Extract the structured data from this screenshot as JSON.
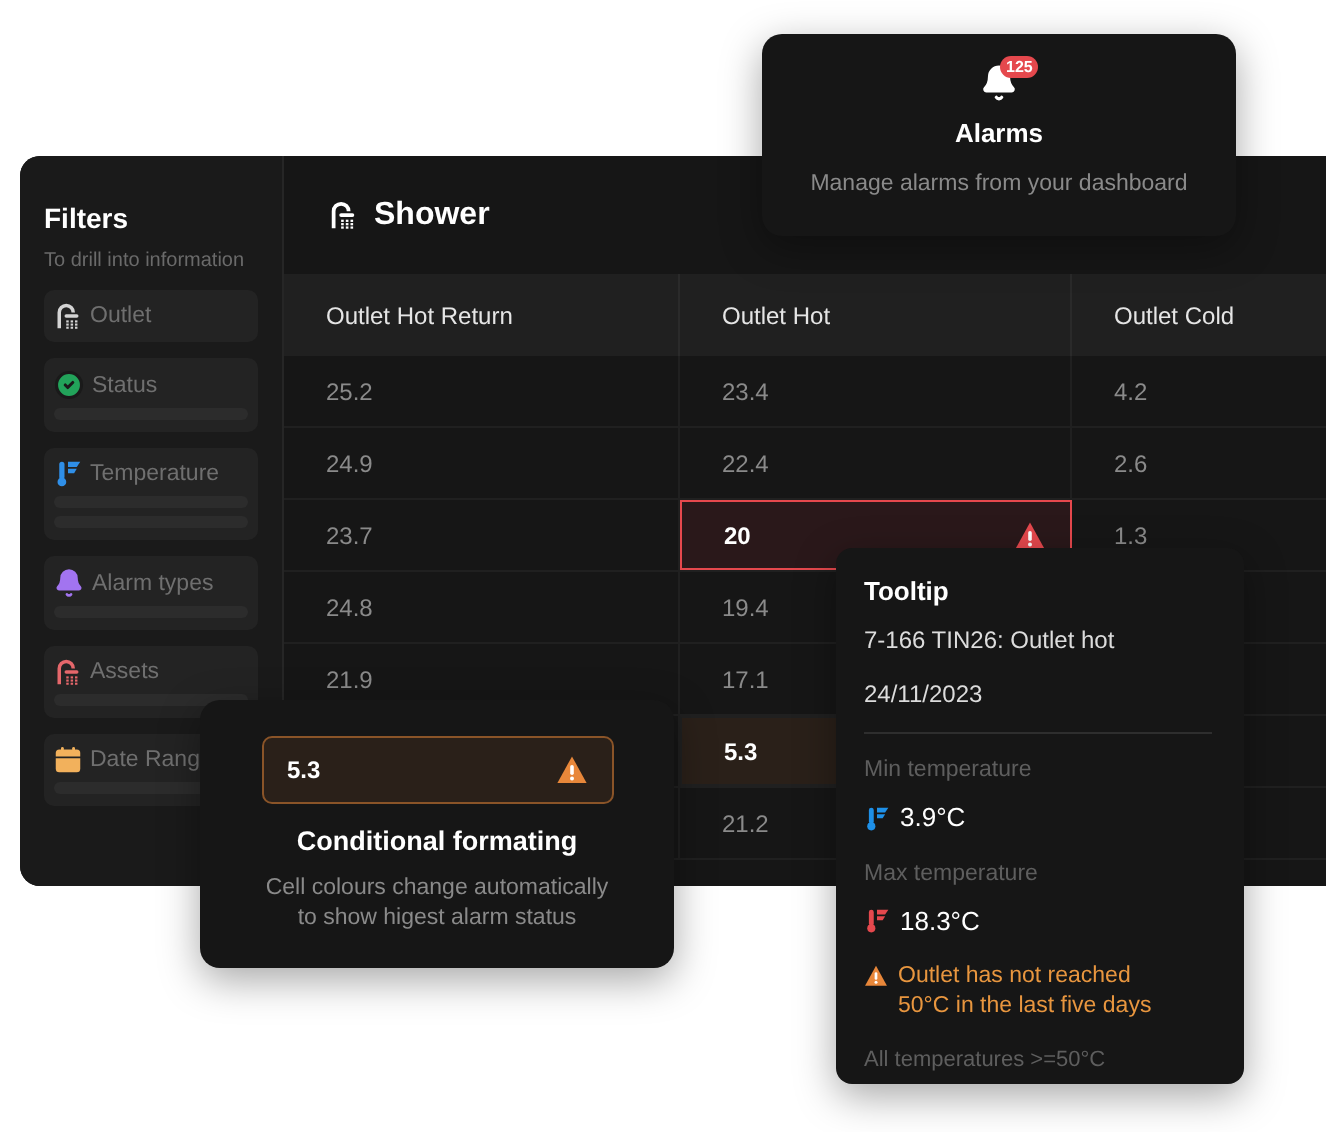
{
  "filters": {
    "title": "Filters",
    "subtitle": "To drill into information",
    "items": [
      {
        "label": "Outlet",
        "color": "#d4d4d4",
        "kind": "outlet"
      },
      {
        "label": "Status",
        "color": "#22a35a",
        "kind": "status"
      },
      {
        "label": "Temperature",
        "color": "#2f8fe8",
        "kind": "temperature"
      },
      {
        "label": "Alarm types",
        "color": "#a274f0",
        "kind": "alarm"
      },
      {
        "label": "Assets",
        "color": "#e5676b",
        "kind": "assets"
      },
      {
        "label": "Date Rang",
        "color": "#f2b15c",
        "kind": "date"
      }
    ]
  },
  "table": {
    "title": "Shower",
    "columns": [
      "Outlet Hot Return",
      "Outlet Hot",
      "Outlet Cold"
    ],
    "rows": [
      {
        "cells": [
          {
            "value": "25.2",
            "kind": "normal"
          },
          {
            "value": "23.4",
            "kind": "normal"
          },
          {
            "value": "4.2",
            "kind": "normal"
          }
        ]
      },
      {
        "cells": [
          {
            "value": "24.9",
            "kind": "normal"
          },
          {
            "value": "22.4",
            "kind": "normal"
          },
          {
            "value": "2.6",
            "kind": "normal"
          }
        ]
      },
      {
        "cells": [
          {
            "value": "23.7",
            "kind": "normal"
          },
          {
            "value": "20",
            "kind": "alarm"
          },
          {
            "value": "1.3",
            "kind": "normal"
          }
        ]
      },
      {
        "cells": [
          {
            "value": "24.8",
            "kind": "normal"
          },
          {
            "value": "19.4",
            "kind": "normal"
          },
          null
        ]
      },
      {
        "cells": [
          {
            "value": "21.9",
            "kind": "normal"
          },
          {
            "value": "17.1",
            "kind": "normal"
          },
          null
        ]
      },
      {
        "cells": [
          null,
          {
            "value": "5.3",
            "kind": "warning"
          },
          null
        ]
      },
      {
        "cells": [
          null,
          {
            "value": "21.2",
            "kind": "normal"
          },
          null
        ]
      }
    ]
  },
  "alarms_card": {
    "badge": "125",
    "title": "Alarms",
    "description": "Manage alarms from your dashboard"
  },
  "formatting_card": {
    "sample": {
      "value": "5.3",
      "kind": "warning"
    },
    "title": "Conditional formating",
    "description": "Cell colours change automatically to show higest alarm status"
  },
  "tooltip": {
    "title": "Tooltip",
    "sensor": "7-166 TIN26: Outlet hot",
    "date": "24/11/2023",
    "readings": [
      {
        "label": "Min temperature",
        "value": "3.9°C",
        "color": "#1e90e8"
      },
      {
        "label": "Max temperature",
        "value": "18.3°C",
        "color": "#e5484d"
      }
    ],
    "warning": "Outlet has not reached 50°C in the last five days",
    "footer": "All temperatures >=50°C"
  }
}
